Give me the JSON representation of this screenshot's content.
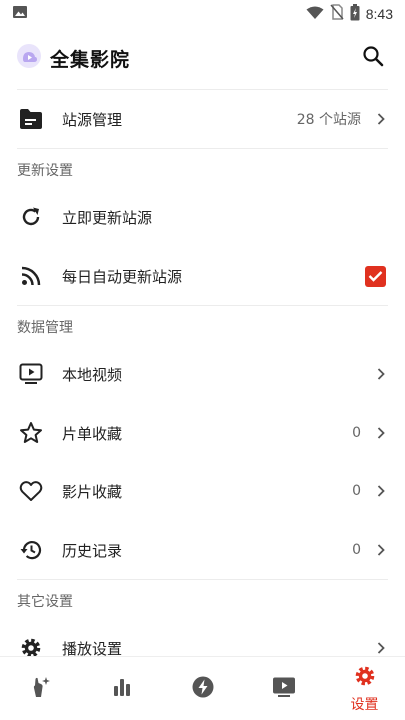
{
  "status": {
    "time": "8:43"
  },
  "header": {
    "title": "全集影院"
  },
  "source": {
    "label": "站源管理",
    "count": "28 个站源"
  },
  "update_section": {
    "title": "更新设置",
    "refresh_label": "立即更新站源",
    "auto_label": "每日自动更新站源",
    "auto_checked": true
  },
  "data_section": {
    "title": "数据管理",
    "local_label": "本地视频",
    "playlist_label": "片单收藏",
    "playlist_count": "0",
    "movie_label": "影片收藏",
    "movie_count": "0",
    "history_label": "历史记录",
    "history_count": "0"
  },
  "other_section": {
    "title": "其它设置",
    "playback_label": "播放设置"
  },
  "nav": {
    "settings_label": "设置"
  },
  "colors": {
    "accent": "#e0311f",
    "logo": "#b9a7f0",
    "text": "#222222",
    "muted": "#666666"
  }
}
